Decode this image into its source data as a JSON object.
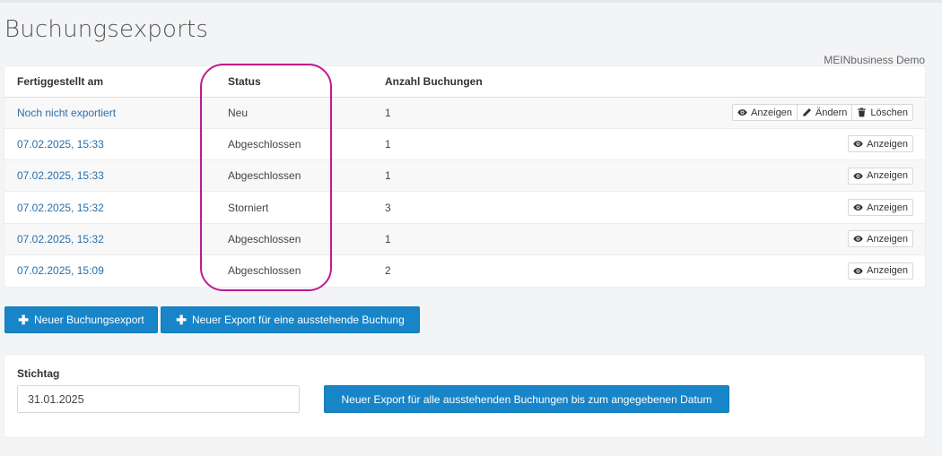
{
  "page": {
    "title": "Buchungsexports",
    "company": "MEINbusiness Demo"
  },
  "table": {
    "headers": [
      "Fertiggestellt am",
      "Status",
      "Anzahl Buchungen"
    ],
    "rows": [
      {
        "date": "Noch nicht exportiert",
        "status": "Neu",
        "count": "1"
      },
      {
        "date": "07.02.2025, 15:33",
        "status": "Abgeschlossen",
        "count": "1"
      },
      {
        "date": "07.02.2025, 15:33",
        "status": "Abgeschlossen",
        "count": "1"
      },
      {
        "date": "07.02.2025, 15:32",
        "status": "Storniert",
        "count": "3"
      },
      {
        "date": "07.02.2025, 15:32",
        "status": "Abgeschlossen",
        "count": "1"
      },
      {
        "date": "07.02.2025, 15:09",
        "status": "Abgeschlossen",
        "count": "2"
      }
    ],
    "actions": {
      "view": "Anzeigen",
      "edit": "Ändern",
      "delete": "Löschen"
    }
  },
  "buttons": {
    "new_export": "Neuer Buchungsexport",
    "new_pending_export": "Neuer Export für eine ausstehende Buchung"
  },
  "stichtag": {
    "label": "Stichtag",
    "value": "31.01.2025",
    "submit": "Neuer Export für alle ausstehenden Buchungen bis zum angegebenen Datum"
  },
  "colors": {
    "primary": "#1785c8",
    "link": "#2a6fa8",
    "highlight": "#c21a8e"
  }
}
